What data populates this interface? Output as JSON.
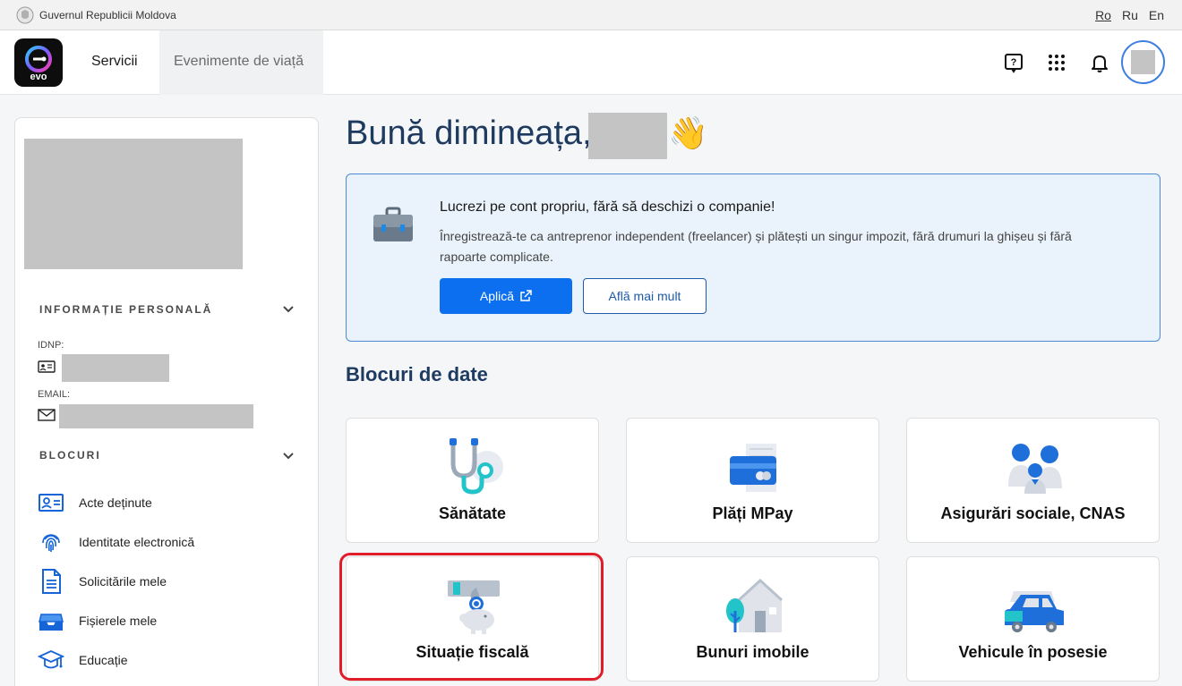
{
  "govbar": {
    "name": "Guvernul Republicii Moldova",
    "languages": [
      "Ro",
      "Ru",
      "En"
    ],
    "active_language": "Ro"
  },
  "header": {
    "logo_text": "evo",
    "nav": {
      "servicii": "Servicii",
      "evenimente": "Evenimente de viață"
    },
    "icons": [
      "help-icon",
      "apps-grid-icon",
      "bell-icon"
    ]
  },
  "sidebar": {
    "personal_section_title": "INFORMAȚIE PERSONALĂ",
    "idnp_label": "IDNP:",
    "email_label": "EMAIL:",
    "blocks_section_title": "BLOCURI",
    "items": [
      {
        "label": "Acte deținute",
        "icon": "id-card-icon"
      },
      {
        "label": "Identitate electronică",
        "icon": "fingerprint-icon"
      },
      {
        "label": "Solicitările mele",
        "icon": "document-icon"
      },
      {
        "label": "Fișierele mele",
        "icon": "inbox-tray-icon"
      },
      {
        "label": "Educație",
        "icon": "graduation-cap-icon"
      }
    ]
  },
  "main": {
    "greeting": "Bună dimineața,",
    "greeting_emoji": "👋",
    "banner": {
      "title": "Lucrezi pe cont propriu, fără să deschizi o companie!",
      "description": "Înregistrează-te ca antreprenor independent (freelancer) și plătești un singur impozit, fără drumuri la ghișeu și fără rapoarte complicate.",
      "primary_button": "Aplică",
      "secondary_button": "Află mai mult"
    },
    "blocks_title": "Blocuri de date",
    "cards": [
      {
        "label": "Sănătate",
        "icon": "stethoscope-icon"
      },
      {
        "label": "Plăți MPay",
        "icon": "payment-card-icon"
      },
      {
        "label": "Asigurări sociale, CNAS",
        "icon": "family-icon"
      },
      {
        "label": "Situație fiscală",
        "icon": "piggy-bank-coin-icon"
      },
      {
        "label": "Bunuri imobile",
        "icon": "house-tree-icon"
      },
      {
        "label": "Vehicule în posesie",
        "icon": "car-icon"
      }
    ]
  },
  "colors": {
    "primary": "#0b6fef",
    "heading": "#1f3a5f",
    "banner_bg": "#eaf3fb",
    "highlight": "#e11d2a"
  }
}
